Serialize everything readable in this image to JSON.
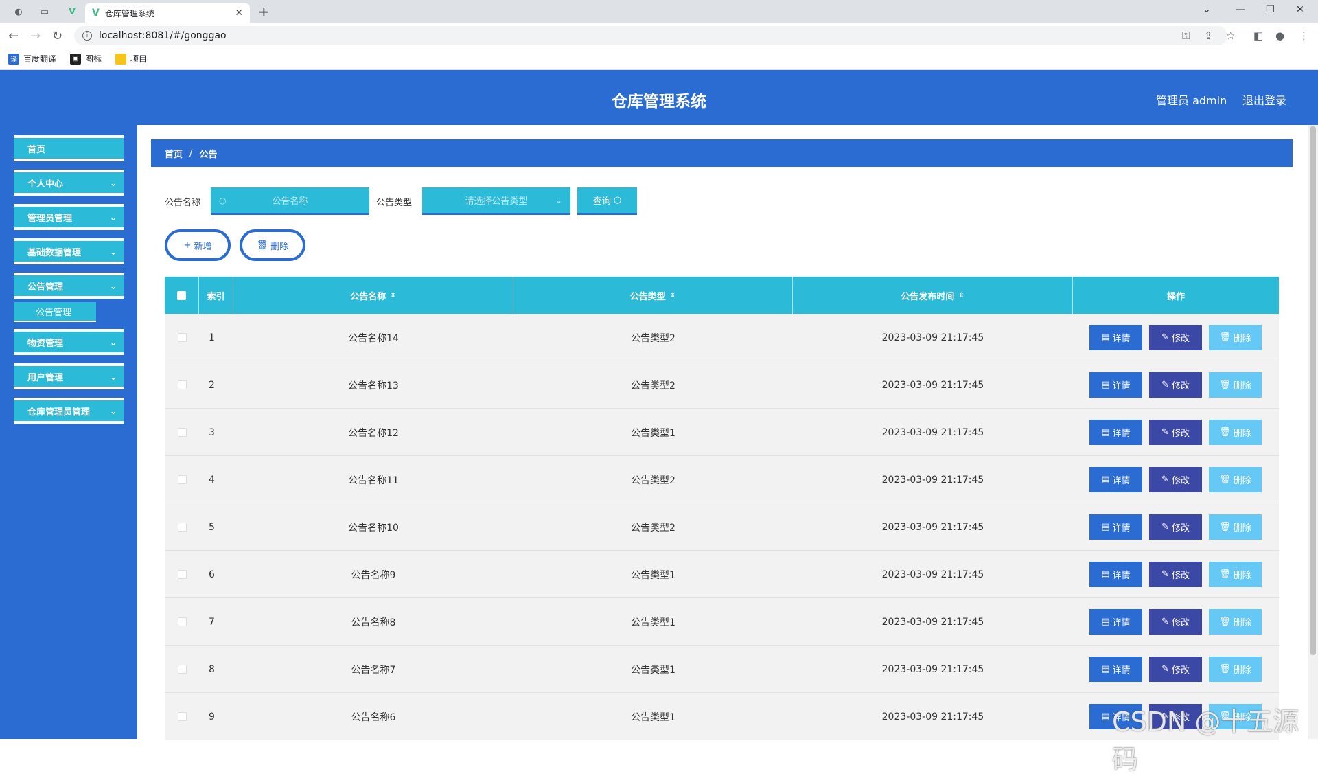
{
  "browser": {
    "tab_title": "仓库管理系统",
    "url": "localhost:8081/#/gonggao",
    "bookmarks": [
      {
        "label": "百度翻译",
        "icon": "translate-icon"
      },
      {
        "label": "图标",
        "icon": "image-icon"
      },
      {
        "label": "项目",
        "icon": "folder-icon"
      }
    ]
  },
  "header": {
    "title": "仓库管理系统",
    "user": "管理员 admin",
    "logout": "退出登录"
  },
  "sidebar": {
    "items": [
      {
        "label": "首页"
      },
      {
        "label": "个人中心"
      },
      {
        "label": "管理员管理"
      },
      {
        "label": "基础数据管理"
      },
      {
        "label": "公告管理"
      },
      {
        "label": "物资管理"
      },
      {
        "label": "用户管理"
      },
      {
        "label": "仓库管理员管理"
      }
    ],
    "active_sub": "公告管理"
  },
  "breadcrumb": {
    "home": "首页",
    "current": "公告"
  },
  "search": {
    "name_label": "公告名称",
    "name_placeholder": "公告名称",
    "type_label": "公告类型",
    "type_placeholder": "请选择公告类型",
    "query_button": "查询"
  },
  "actions": {
    "add": "新增",
    "delete": "删除"
  },
  "table": {
    "headers": {
      "index": "索引",
      "name": "公告名称",
      "type": "公告类型",
      "time": "公告发布时间",
      "ops": "操作"
    },
    "row_buttons": {
      "detail": "详情",
      "edit": "修改",
      "delete": "删除"
    },
    "rows": [
      {
        "index": "1",
        "name": "公告名称14",
        "type": "公告类型2",
        "time": "2023-03-09 21:17:45"
      },
      {
        "index": "2",
        "name": "公告名称13",
        "type": "公告类型2",
        "time": "2023-03-09 21:17:45"
      },
      {
        "index": "3",
        "name": "公告名称12",
        "type": "公告类型1",
        "time": "2023-03-09 21:17:45"
      },
      {
        "index": "4",
        "name": "公告名称11",
        "type": "公告类型2",
        "time": "2023-03-09 21:17:45"
      },
      {
        "index": "5",
        "name": "公告名称10",
        "type": "公告类型2",
        "time": "2023-03-09 21:17:45"
      },
      {
        "index": "6",
        "name": "公告名称9",
        "type": "公告类型1",
        "time": "2023-03-09 21:17:45"
      },
      {
        "index": "7",
        "name": "公告名称8",
        "type": "公告类型1",
        "time": "2023-03-09 21:17:45"
      },
      {
        "index": "8",
        "name": "公告名称7",
        "type": "公告类型1",
        "time": "2023-03-09 21:17:45"
      },
      {
        "index": "9",
        "name": "公告名称6",
        "type": "公告类型1",
        "time": "2023-03-09 21:17:45"
      }
    ]
  },
  "watermark": "CSDN @十五源码",
  "colors": {
    "primary": "#2a6cd1",
    "accent": "#2bbbd8",
    "edit": "#3c48a6",
    "delete": "#66c9f5"
  }
}
